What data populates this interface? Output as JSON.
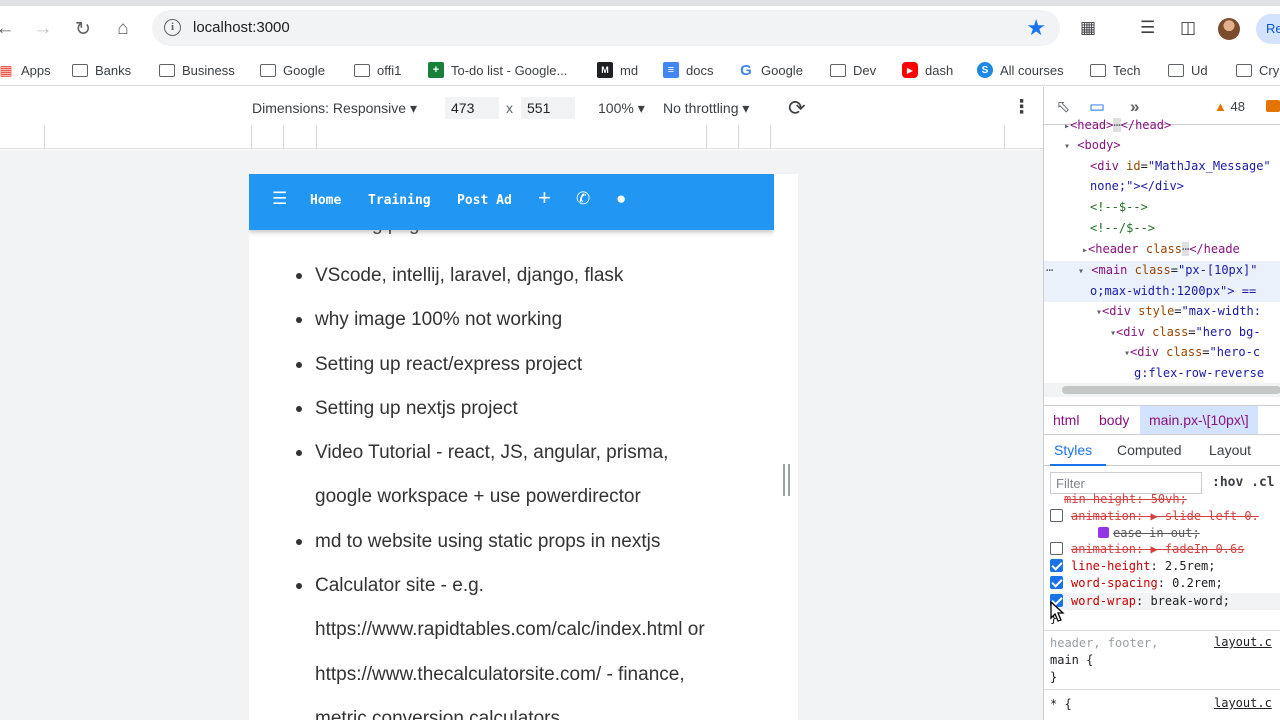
{
  "browser": {
    "url": "localhost:3000",
    "profile_label": "Re",
    "bookmarks": [
      {
        "label": "Apps",
        "icon": "apps-grid-icon"
      },
      {
        "label": "Banks",
        "icon": "folder-icon"
      },
      {
        "label": "Business",
        "icon": "folder-icon"
      },
      {
        "label": "Google",
        "icon": "folder-icon"
      },
      {
        "label": "offi1",
        "icon": "folder-icon"
      },
      {
        "label": "To-do list - Google...",
        "icon": "sheets-icon"
      },
      {
        "label": "md",
        "icon": "md-icon"
      },
      {
        "label": "docs",
        "icon": "docs-icon"
      },
      {
        "label": "Google",
        "icon": "google-icon"
      },
      {
        "label": "Dev",
        "icon": "folder-icon"
      },
      {
        "label": "dash",
        "icon": "youtube-icon"
      },
      {
        "label": "All courses",
        "icon": "courses-icon"
      },
      {
        "label": "Tech",
        "icon": "folder-icon"
      },
      {
        "label": "Ud",
        "icon": "folder-icon"
      },
      {
        "label": "Cry",
        "icon": "folder-icon"
      }
    ]
  },
  "device_toolbar": {
    "dimensions_label": "Dimensions: Responsive",
    "width": "473",
    "height": "551",
    "times": "x",
    "zoom": "100%",
    "throttling": "No throttling"
  },
  "site": {
    "nav": {
      "home": "Home",
      "training": "Training",
      "post_ad": "Post Ad"
    },
    "partial_item": "Landing page",
    "list_lines": [
      "VScode, intellij, laravel, django, flask",
      "why image 100% not working",
      "Setting up react/express project",
      "Setting up nextjs project",
      "Video Tutorial - react, JS, angular, prisma,",
      "google workspace + use powerdirector",
      "md to website using static props in nextjs",
      "Calculator site - e.g.",
      "https://www.rapidtables.com/calc/index.html or",
      "https://www.thecalculatorsite.com/ - finance,",
      "metric conversion calculators"
    ]
  },
  "devtools": {
    "warnings": "48",
    "dom": {
      "head": "<head>",
      "head_end": "</head>",
      "body": "<body>",
      "div_open": "<div",
      "div_attr": "id",
      "div_val": "\"MathJax_Message\"",
      "div_cont": "none;\"></div>",
      "comment1": "<!--$-->",
      "comment2": "<!--/$-->",
      "header_open": "<header",
      "header_attr": "class",
      "header_close": "</heade",
      "main_open": "<main",
      "main_attr": "class",
      "main_val": "\"px-[10px]\"",
      "main_cont": "o;max-width:1200px\"> ==",
      "div2_open": "<div",
      "div2_attr": "style",
      "div2_val": "\"max-width:",
      "div3_open": "<div",
      "div3_attr": "class",
      "div3_val": "\"hero bg-",
      "div4_open": "<div",
      "div4_attr": "class",
      "div4_val": "\"hero-c",
      "div4_cont": "g:flex-row-reverse"
    },
    "breadcrumbs": [
      "html",
      "body",
      "main.px-\\[10px\\]"
    ],
    "style_tabs": [
      "Styles",
      "Computed",
      "Layout"
    ],
    "filter_placeholder": "Filter",
    "hov_cls": ":hov  .cl",
    "css": {
      "l0_prop": "min-height",
      "l0_val": ": 50vh;",
      "l1_prop": "animation",
      "l1_val": ": ▶ slide-left 0.",
      "l1b_val": "ease-in-out;",
      "l2_prop": "animation",
      "l2_val": ": ▶ fadeIn 0.6s",
      "l3_prop": "line-height",
      "l3_val": ": 2.5rem;",
      "l4_prop": "word-spacing",
      "l4_val": ": 0.2rem;",
      "l5_prop": "word-wrap",
      "l5_val": ": break-word;",
      "close": "}",
      "rule2_selector_dim": "header, footer,",
      "rule2_selector": "main {",
      "rule2_close": "}",
      "rule2_src": "layout.c",
      "rule3_selector": "* {",
      "rule3_src": "layout.c"
    }
  }
}
